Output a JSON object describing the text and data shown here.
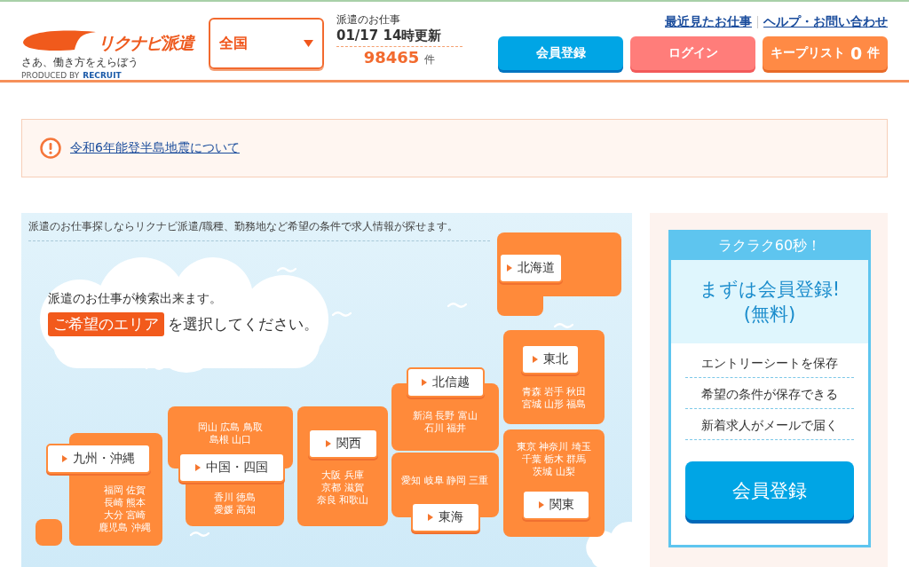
{
  "header": {
    "logo": {
      "brand": "リクナビ派遣",
      "tagline": "さあ、働き方をえらぼう",
      "produced_by": "PRODUCED BY",
      "company": "RECRUIT"
    },
    "area_select": {
      "value": "全国"
    },
    "job_count": {
      "label": "派遣のお仕事",
      "updated": "01/17 14時更新",
      "count": "98465",
      "unit": "件"
    },
    "links": [
      "最近見たお仕事",
      "ヘルプ・お問い合わせ"
    ],
    "buttons": [
      {
        "kind": "register",
        "label": "会員登録"
      },
      {
        "kind": "login",
        "label": "ログイン"
      },
      {
        "kind": "keep",
        "label": "キープリスト",
        "count": "0",
        "unit": "件"
      }
    ]
  },
  "notice": {
    "link": "令和6年能登半島地震について"
  },
  "area_map": {
    "intro": "派遣のお仕事探しならリクナビ派遣/職種、勤務地など希望の条件で求人情報が探せます。",
    "prompt_line1": "派遣のお仕事が検索出来ます。",
    "highlight": "ご希望のエリア",
    "prompt_line2": "を選択してください。",
    "regions": [
      {
        "name": "北海道"
      },
      {
        "name": "東北",
        "prefecture_groups": [
          [
            "青森 岩手 秋田",
            "宮城 山形 福島"
          ]
        ]
      },
      {
        "name": "北信越",
        "prefecture_groups": [
          [
            "新潟 長野 富山",
            "石川 福井"
          ]
        ]
      },
      {
        "name": "中国・四国",
        "prefecture_groups": [
          [
            "岡山 広島 鳥取",
            "島根 山口"
          ],
          [
            "香川 徳島",
            "愛媛 高知"
          ]
        ]
      },
      {
        "name": "関西",
        "prefecture_groups": [
          [
            "大阪 兵庫",
            "京都 滋賀",
            "奈良 和歌山"
          ]
        ]
      },
      {
        "name": "九州・沖縄",
        "prefecture_groups": [
          [
            "福岡 佐賀",
            "長崎 熊本",
            "大分 宮崎",
            "鹿児島 沖縄"
          ]
        ]
      },
      {
        "name": "東海",
        "prefecture_groups": [
          [
            "愛知 岐阜 静岡 三重"
          ]
        ]
      },
      {
        "name": "関東",
        "prefecture_groups": [
          [
            "東京 神奈川 埼玉",
            "千葉 栃木 群馬",
            "茨城 山梨"
          ]
        ]
      }
    ]
  },
  "signup_card": {
    "badge": "ラクラク60秒！",
    "headline": "まずは会員登録!",
    "subline": "(無料)",
    "benefits": [
      "エントリーシートを保存",
      "希望の条件が保存できる",
      "新着求人がメールで届く"
    ],
    "button": "会員登録"
  }
}
